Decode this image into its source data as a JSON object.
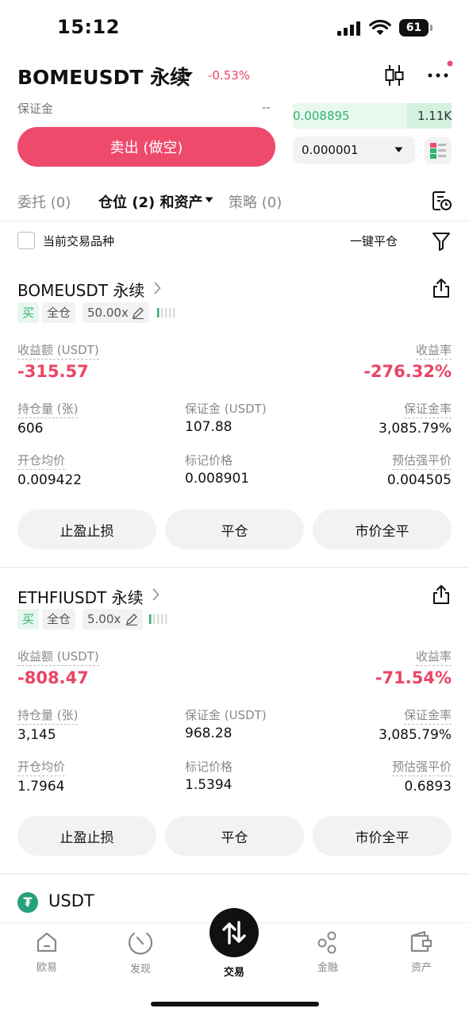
{
  "status_bar": {
    "time": "15:12",
    "battery": "61"
  },
  "header": {
    "pair": "BOMEUSDT 永续",
    "change": "-0.53%"
  },
  "order_panel": {
    "margin_label": "保证金",
    "margin_value": "--",
    "sell_button": "卖出 (做空)",
    "book_price": "0.008895",
    "book_qty": "1.11K",
    "step_value": "0.000001"
  },
  "tabs": [
    {
      "label": "委托 (0)"
    },
    {
      "label": "仓位 (2) 和资产"
    },
    {
      "label": "策略 (0)"
    }
  ],
  "filter": {
    "checkbox_label": "当前交易品种",
    "close_all": "一键平仓"
  },
  "positions": [
    {
      "symbol": "BOMEUSDT 永续",
      "side": "买",
      "margin_mode": "全仓",
      "leverage": "50.00x",
      "pnl_label": "收益额 (USDT)",
      "pnl_value": "-315.57",
      "roe_label": "收益率",
      "roe_value": "-276.32%",
      "size_label": "持仓量 (张)",
      "size_value": "606",
      "margin_label": "保证金 (USDT)",
      "margin_value": "107.88",
      "margin_ratio_label": "保证金率",
      "margin_ratio_value": "3,085.79%",
      "entry_label": "开仓均价",
      "entry_value": "0.009422",
      "mark_label": "标记价格",
      "mark_value": "0.008901",
      "liq_label": "预估强平价",
      "liq_value": "0.004505",
      "btn_tpsl": "止盈止损",
      "btn_close": "平仓",
      "btn_market_close": "市价全平"
    },
    {
      "symbol": "ETHFIUSDT 永续",
      "side": "买",
      "margin_mode": "全仓",
      "leverage": "5.00x",
      "pnl_label": "收益额 (USDT)",
      "pnl_value": "-808.47",
      "roe_label": "收益率",
      "roe_value": "-71.54%",
      "size_label": "持仓量 (张)",
      "size_value": "3,145",
      "margin_label": "保证金 (USDT)",
      "margin_value": "968.28",
      "margin_ratio_label": "保证金率",
      "margin_ratio_value": "3,085.79%",
      "entry_label": "开仓均价",
      "entry_value": "1.7964",
      "mark_label": "标记价格",
      "mark_value": "1.5394",
      "liq_label": "预估强平价",
      "liq_value": "0.6893",
      "btn_tpsl": "止盈止损",
      "btn_close": "平仓",
      "btn_market_close": "市价全平"
    }
  ],
  "assets": {
    "usdt_label": "USDT",
    "usdt_logo": "₮"
  },
  "bottom_nav": [
    {
      "label": "欧易",
      "icon": "home-icon"
    },
    {
      "label": "发现",
      "icon": "discover-icon"
    },
    {
      "label": "交易",
      "icon": "trade-icon"
    },
    {
      "label": "金融",
      "icon": "finance-icon"
    },
    {
      "label": "资产",
      "icon": "wallet-icon"
    }
  ],
  "colors": {
    "loss": "#e94565",
    "gain": "#2fb36b",
    "sell": "#ee4a6c"
  }
}
